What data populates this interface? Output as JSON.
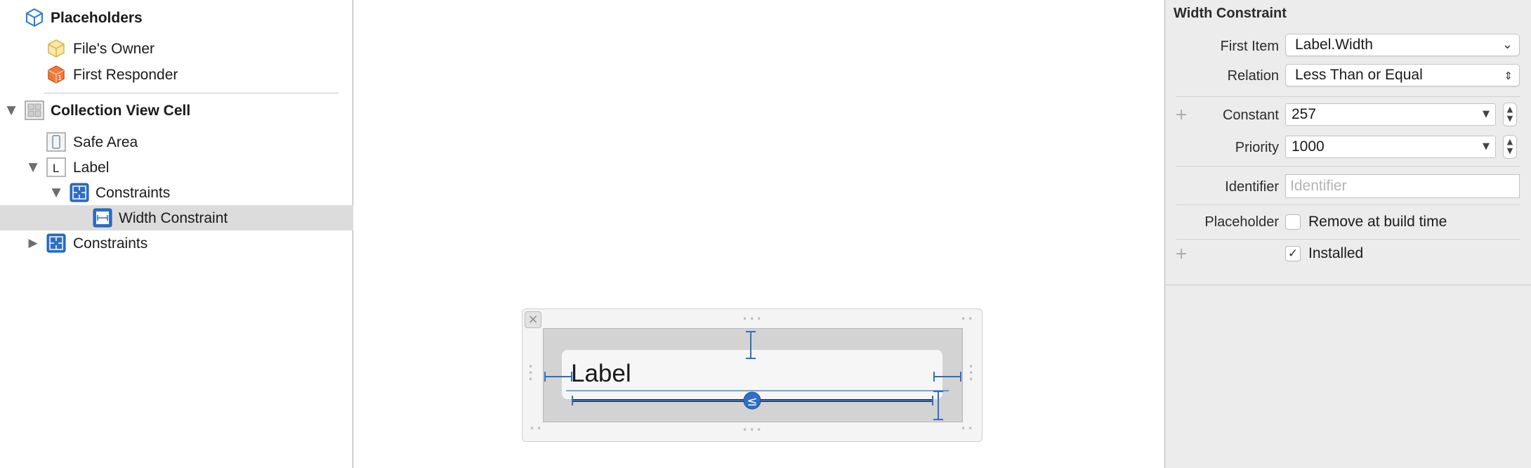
{
  "outline": {
    "items": [
      {
        "label": "Placeholders",
        "icon": "cube-icon",
        "bold": true
      },
      {
        "label": "File's Owner",
        "icon": "placeholder-cube-icon"
      },
      {
        "label": "First Responder",
        "icon": "first-responder-icon"
      },
      {
        "label": "Collection View Cell",
        "icon": "collection-view-cell-icon",
        "bold": true,
        "expanded": true
      },
      {
        "label": "Safe Area",
        "icon": "safe-area-icon"
      },
      {
        "label": "Label",
        "icon": "label-icon",
        "expanded": true
      },
      {
        "label": "Constraints",
        "icon": "constraints-icon",
        "expanded": true
      },
      {
        "label": "Width Constraint",
        "icon": "width-constraint-icon",
        "selected": true
      },
      {
        "label": "Constraints",
        "icon": "constraints-icon",
        "expanded": false
      }
    ]
  },
  "canvas": {
    "label_text": "Label",
    "relation_glyph": "≤"
  },
  "inspector": {
    "title": "Width Constraint",
    "first_item": {
      "label": "First Item",
      "value": "Label.Width"
    },
    "relation": {
      "label": "Relation",
      "value": "Less Than or Equal"
    },
    "constant": {
      "label": "Constant",
      "value": "257"
    },
    "priority": {
      "label": "Priority",
      "value": "1000"
    },
    "identifier": {
      "label": "Identifier",
      "placeholder": "Identifier",
      "value": ""
    },
    "placeholder": {
      "label": "Placeholder",
      "checkbox_label": "Remove at build time",
      "checked": false
    },
    "installed": {
      "checkbox_label": "Installed",
      "checked": true
    }
  },
  "colors": {
    "selection_row": "#dcdcdc",
    "constraint_blue": "#2f6fc4",
    "icon_blue": "#2a7ad8",
    "inspector_bg": "#ececec"
  }
}
